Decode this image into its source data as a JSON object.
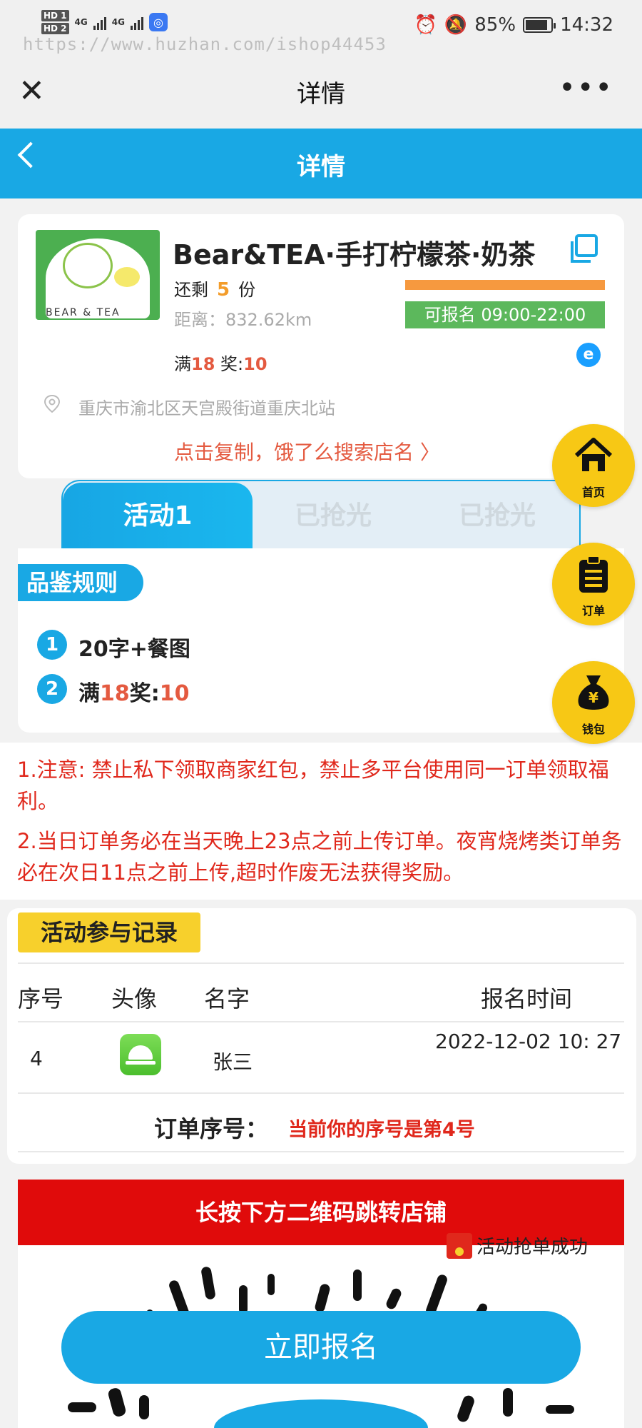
{
  "status_bar": {
    "sim1": "HD 1",
    "sim2": "HD 2",
    "net1": "4G",
    "net2": "4G",
    "battery": "85%",
    "time": "14:32",
    "watermark": "https://www.huzhan.com/ishop44453"
  },
  "wechat_header": {
    "title": "详情"
  },
  "page_header": {
    "title": "详情"
  },
  "store": {
    "name": "Bear&TEA·手打柠檬茶·奶茶",
    "logo_text": "BEAR & TEA",
    "remain_prefix": "还剩",
    "remain_count": "5",
    "remain_unit": "份",
    "distance": "距离：832.62km",
    "open_badge": "可报名 09:00-22:00",
    "reward_full_label": "满",
    "reward_full_value": "18",
    "reward_prize_label": " 奖:",
    "reward_prize_value": "10",
    "platform_icon": "e",
    "address": "重庆市渝北区天宫殿街道重庆北站",
    "copy_hint": "点击复制，饿了么搜索店名 〉"
  },
  "tabs": [
    {
      "label": "活动1",
      "active": true
    },
    {
      "label": "已抢光",
      "active": false
    },
    {
      "label": "已抢光",
      "active": false
    }
  ],
  "rules": {
    "title": "品鉴规则",
    "items": [
      {
        "num": "1",
        "text": "20字+餐图"
      },
      {
        "num": "2",
        "prefix": "满",
        "full": "18",
        "middle": "奖:",
        "prize": "10"
      }
    ]
  },
  "notice": {
    "line1": "1.注意: 禁止私下领取商家红包，禁止多平台使用同一订单领取福利。",
    "line2": "2.当日订单务必在当天晚上23点之前上传订单。夜宵烧烤类订单务必在次日11点之前上传,超时作废无法获得奖励。"
  },
  "records": {
    "title": "活动参与记录",
    "columns": [
      "序号",
      "头像",
      "名字",
      "报名时间"
    ],
    "rows": [
      {
        "index": "4",
        "name": "张三",
        "time": "2022-12-02 10:  27"
      }
    ],
    "order_label": "订单序号：",
    "order_value": "当前你的序号是第4号"
  },
  "banner": {
    "text": "长按下方二维码跳转店铺"
  },
  "toast": {
    "text": "活动抢单成功"
  },
  "signup_button": {
    "label": "立即报名"
  },
  "floating_nav": [
    {
      "label": "首页",
      "icon": "home-icon"
    },
    {
      "label": "订单",
      "icon": "clipboard-icon"
    },
    {
      "label": "钱包",
      "icon": "money-bag-icon"
    }
  ],
  "colors": {
    "primary_blue": "#19a8e4",
    "accent_red": "#e0281c",
    "fab_yellow": "#f7c815",
    "badge_green": "#5cb85c",
    "orange": "#f6993f"
  }
}
